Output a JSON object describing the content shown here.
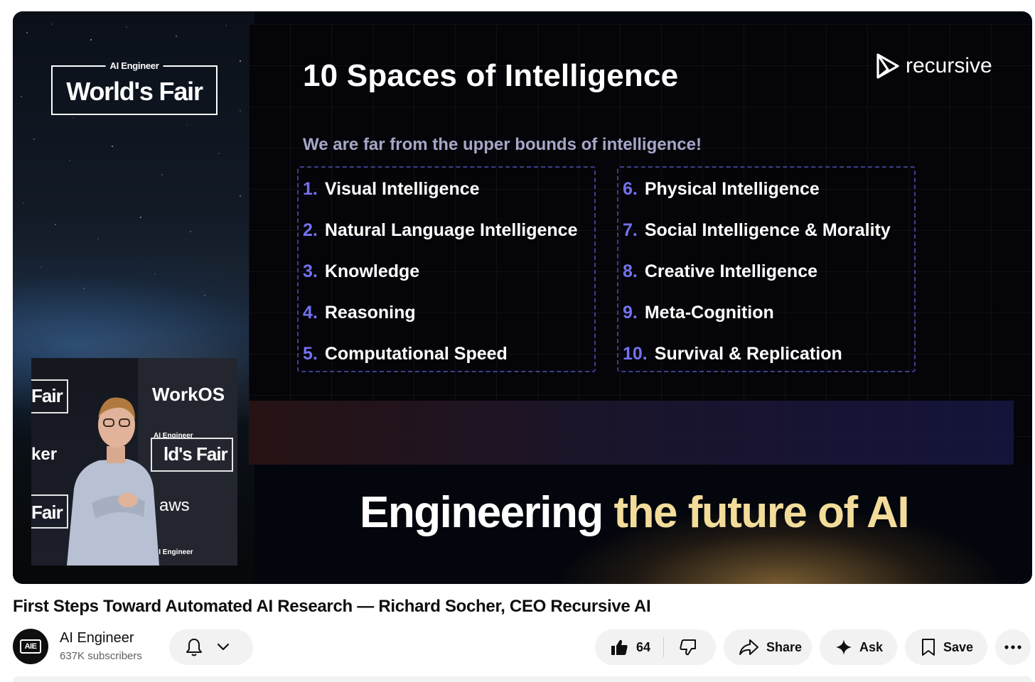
{
  "video": {
    "event_logo": {
      "small": "AI Engineer",
      "big": "World's Fair"
    },
    "slide": {
      "title": "10 Spaces of Intelligence",
      "subtitle": "We are far from the upper bounds of intelligence!",
      "brand": "recursive",
      "left_items": [
        {
          "num": "1.",
          "label": "Visual Intelligence"
        },
        {
          "num": "2.",
          "label": "Natural Language Intelligence"
        },
        {
          "num": "3.",
          "label": "Knowledge"
        },
        {
          "num": "4.",
          "label": "Reasoning"
        },
        {
          "num": "5.",
          "label": "Computational Speed"
        }
      ],
      "right_items": [
        {
          "num": "6.",
          "label": "Physical Intelligence"
        },
        {
          "num": "7.",
          "label": "Social Intelligence & Morality"
        },
        {
          "num": "8.",
          "label": "Creative Intelligence"
        },
        {
          "num": "9.",
          "label": "Meta-Cognition"
        },
        {
          "num": "10.",
          "label": "Survival & Replication"
        }
      ]
    },
    "tagline": {
      "white": "Engineering",
      "gold": "the future of AI"
    },
    "inset_signage": {
      "workos": "WorkOS",
      "fair_1": "Fair",
      "ker": "ker",
      "fair_2": "Fair",
      "small_brand_1": "AI Engineer",
      "worlds_fair": "ld's Fair",
      "aws": "aws",
      "small_brand_2": "AI Engineer"
    },
    "colors": {
      "accent_number": "#7272f0",
      "tagline_gold": "#f3dc9a",
      "dashed_border": "#3e3f8e"
    }
  },
  "title": "First Steps Toward Automated AI Research — Richard Socher, CEO Recursive AI",
  "channel": {
    "avatar_text": "AIE",
    "name": "AI Engineer",
    "subscribers": "637K subscribers"
  },
  "actions": {
    "bell_icon": "bell-icon",
    "like_count": "64",
    "share_label": "Share",
    "ask_label": "Ask",
    "save_label": "Save"
  }
}
